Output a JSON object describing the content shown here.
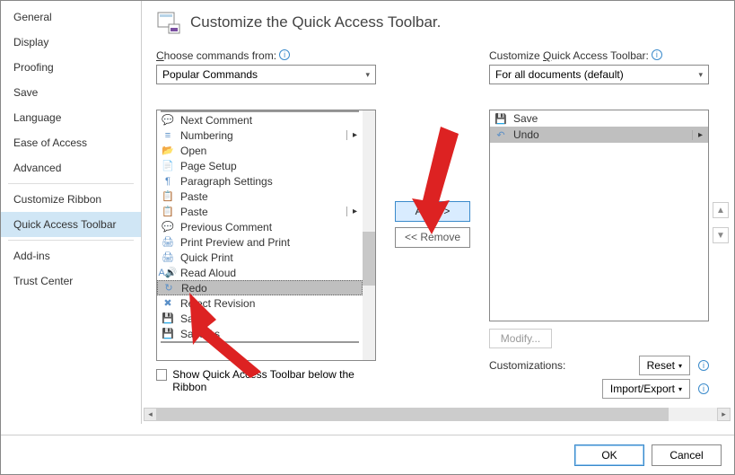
{
  "header": {
    "title": "Customize the Quick Access Toolbar."
  },
  "sidebar": {
    "items": [
      "General",
      "Display",
      "Proofing",
      "Save",
      "Language",
      "Ease of Access",
      "Advanced",
      "Customize Ribbon",
      "Quick Access Toolbar",
      "Add-ins",
      "Trust Center"
    ],
    "selected_index": 8
  },
  "left": {
    "label": "Choose commands from:",
    "dropdown": "Popular Commands",
    "items": [
      {
        "icon": "comment",
        "label": "Next Comment"
      },
      {
        "icon": "numbering",
        "label": "Numbering",
        "has_arrow": true
      },
      {
        "icon": "open",
        "label": "Open"
      },
      {
        "icon": "page-setup",
        "label": "Page Setup"
      },
      {
        "icon": "paragraph",
        "label": "Paragraph Settings"
      },
      {
        "icon": "paste",
        "label": "Paste"
      },
      {
        "icon": "paste",
        "label": "Paste",
        "has_arrow": true
      },
      {
        "icon": "comment",
        "label": "Previous Comment"
      },
      {
        "icon": "print-preview",
        "label": "Print Preview and Print"
      },
      {
        "icon": "quick-print",
        "label": "Quick Print"
      },
      {
        "icon": "read-aloud",
        "label": "Read Aloud"
      },
      {
        "icon": "redo",
        "label": "Redo",
        "selected": true
      },
      {
        "icon": "reject",
        "label": "Reject Revision"
      },
      {
        "icon": "save",
        "label": "Save"
      },
      {
        "icon": "save-as",
        "label": "Save As"
      }
    ],
    "checkbox_label": "Show Quick Access Toolbar below the Ribbon"
  },
  "mid": {
    "add": "Add >>",
    "remove": "<< Remove"
  },
  "right": {
    "label": "Customize Quick Access Toolbar:",
    "dropdown": "For all documents (default)",
    "items": [
      {
        "icon": "save",
        "label": "Save"
      },
      {
        "icon": "undo",
        "label": "Undo",
        "has_arrow": true,
        "selected": true
      }
    ],
    "modify": "Modify...",
    "customizations_label": "Customizations:",
    "reset": "Reset",
    "import_export": "Import/Export"
  },
  "buttons": {
    "ok": "OK",
    "cancel": "Cancel"
  }
}
